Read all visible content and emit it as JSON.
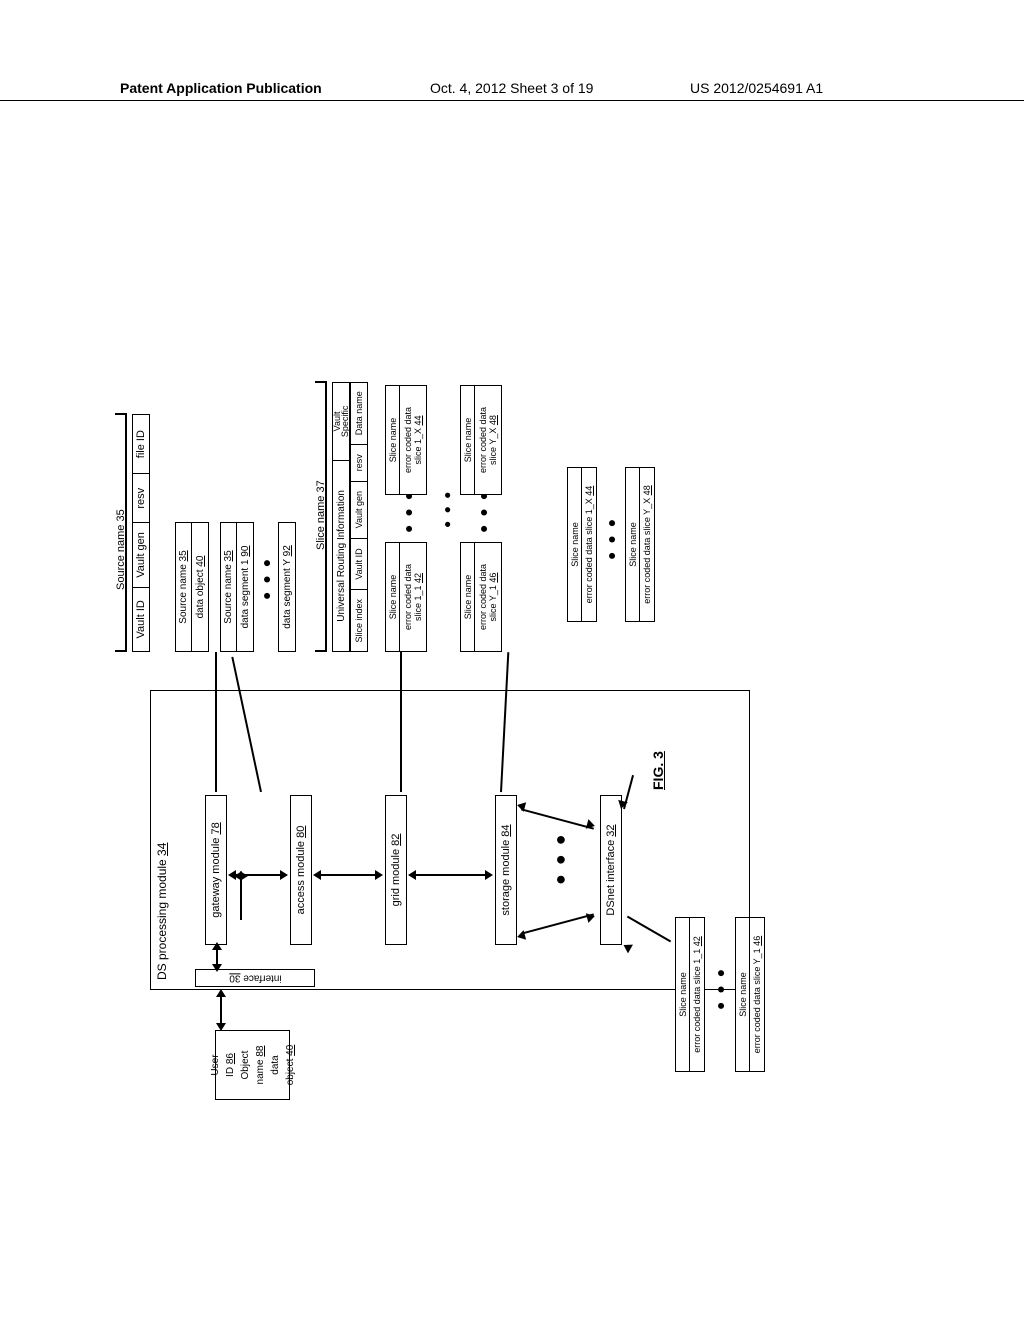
{
  "header": {
    "left": "Patent Application Publication",
    "center": "Oct. 4, 2012  Sheet 3 of 19",
    "right": "US 2012/0254691 A1"
  },
  "figure_label": "FIG. 3",
  "input_block": {
    "user_id": "User ID 86",
    "object_name": "Object name 88",
    "data_object": "data object 40"
  },
  "ds_module": {
    "title": "DS processing module 34",
    "interface_label": "interface 30",
    "gateway": "gateway module 78",
    "access": "access module 80",
    "grid": "grid module 82",
    "storage": "storage module 84",
    "dsnet": "DSnet interface 32"
  },
  "source_name_block": {
    "title": "Source name 35",
    "vault_id": "Vault ID",
    "vault_gen": "Vault gen",
    "resv": "resv",
    "file_id": "file ID"
  },
  "data_layers": {
    "source1_label": "Source name 35",
    "data_obj": "data object 40",
    "source2_label": "Source name 35",
    "seg1": "data segment 1 90",
    "segY": "data segment Y 92"
  },
  "slice_name_block": {
    "title": "Slice name 37",
    "uri": "Universal Routing Information",
    "vault_specific": "Vault Specific",
    "slice_index": "Slice index",
    "vault_id": "Vault ID",
    "vault_gen": "Vault gen",
    "resv": "resv",
    "data_name": "Data name"
  },
  "slice_rows": {
    "sn": "Slice name",
    "ec_1_1": "error coded data slice 1_1 42",
    "ec_1_X": "error coded data slice 1_X 44",
    "ec_Y_1": "error coded data slice Y_1 46",
    "ec_Y_X": "error coded data slice Y_X 48"
  },
  "bottom_rows": {
    "sn": "Slice name",
    "ec_1_1": "error coded data slice 1_1 42",
    "ec_Y_1": "error coded data slice Y_1 46",
    "ec_1_X": "error coded data slice 1_X 44",
    "ec_Y_X": "error coded data slice Y_X 48"
  }
}
